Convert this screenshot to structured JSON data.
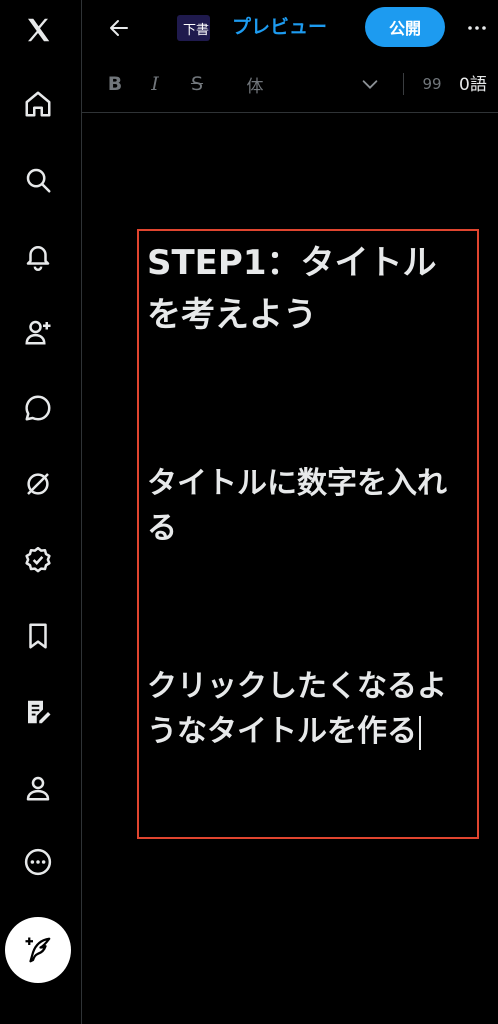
{
  "sidebar": {
    "items": [
      {
        "icon": "x-logo-icon"
      },
      {
        "icon": "home-icon"
      },
      {
        "icon": "search-icon"
      },
      {
        "icon": "bell-icon"
      },
      {
        "icon": "person-add-icon"
      },
      {
        "icon": "chat-bubble-icon"
      },
      {
        "icon": "grok-icon"
      },
      {
        "icon": "verified-icon"
      },
      {
        "icon": "bookmark-icon"
      },
      {
        "icon": "articles-icon"
      },
      {
        "icon": "profile-icon"
      },
      {
        "icon": "more-circle-icon"
      }
    ],
    "post_button_icon": "compose-feather-icon"
  },
  "header": {
    "draft_badge": "下書",
    "preview_label": "プレビュー",
    "publish_label": "公開"
  },
  "toolbar": {
    "bold": "B",
    "italic": "I",
    "strike": "S",
    "style_select": "体",
    "extra": "99",
    "word_count": "0語"
  },
  "editor": {
    "title": "STEP1：タイトルを考えよう",
    "paragraphs": [
      "タイトルに数字を入れる",
      "クリックしたくなるようなタイトルを作る"
    ]
  },
  "colors": {
    "accent": "#1d9bf0",
    "background": "#000000",
    "text": "#e7e9ea",
    "highlight_border": "#e0452f",
    "muted": "#71767b"
  }
}
